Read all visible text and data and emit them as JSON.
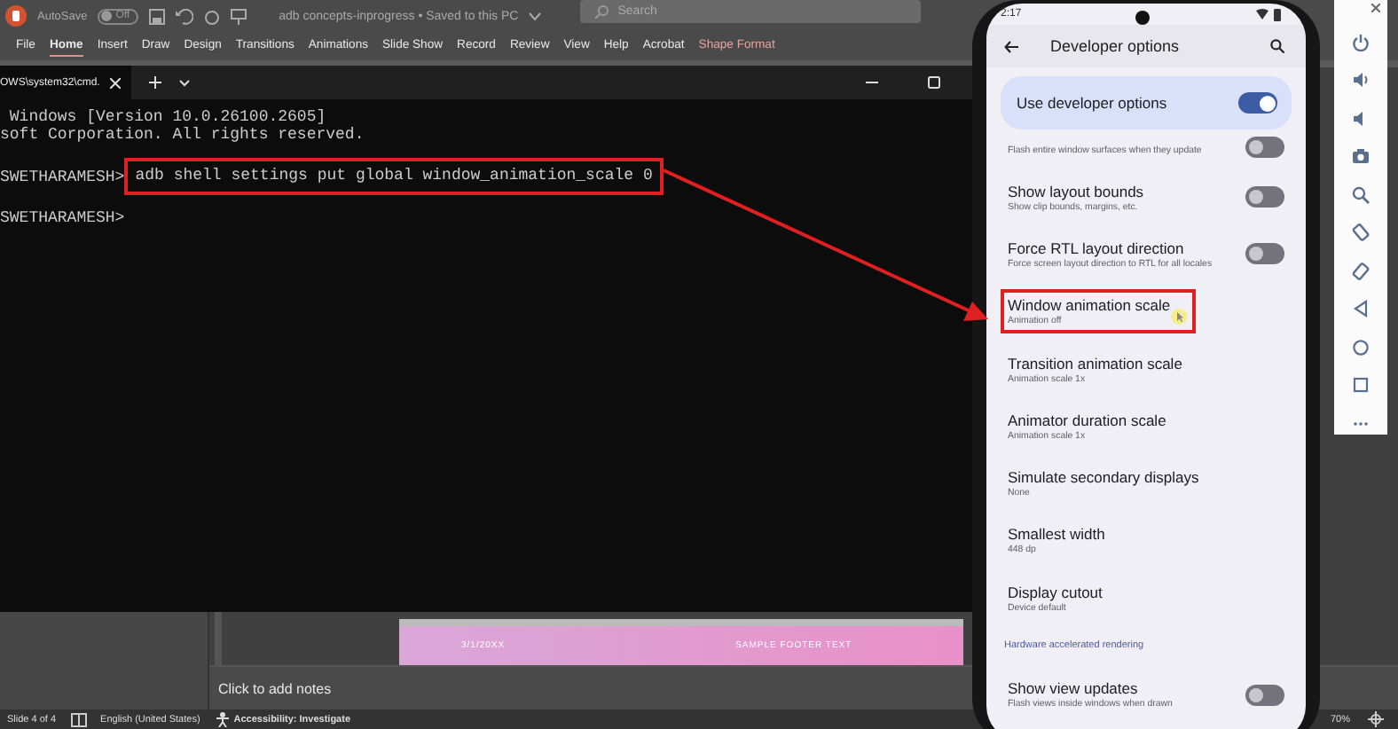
{
  "powerpoint": {
    "autosave_label": "AutoSave",
    "autosave": {
      "label": "Off",
      "on": false
    },
    "document_title": "adb concepts-inprogress • Saved to this PC",
    "search": {
      "placeholder": "Search"
    },
    "ribbon_tabs": [
      {
        "label": "File",
        "selected": false,
        "kind": "standard"
      },
      {
        "label": "Home",
        "selected": true,
        "kind": "standard"
      },
      {
        "label": "Insert",
        "selected": false,
        "kind": "standard"
      },
      {
        "label": "Draw",
        "selected": false,
        "kind": "standard"
      },
      {
        "label": "Design",
        "selected": false,
        "kind": "standard"
      },
      {
        "label": "Transitions",
        "selected": false,
        "kind": "standard"
      },
      {
        "label": "Animations",
        "selected": false,
        "kind": "standard"
      },
      {
        "label": "Slide Show",
        "selected": false,
        "kind": "standard"
      },
      {
        "label": "Record",
        "selected": false,
        "kind": "standard"
      },
      {
        "label": "Review",
        "selected": false,
        "kind": "standard"
      },
      {
        "label": "View",
        "selected": false,
        "kind": "standard"
      },
      {
        "label": "Help",
        "selected": false,
        "kind": "standard"
      },
      {
        "label": "Acrobat",
        "selected": false,
        "kind": "standard"
      },
      {
        "label": "Shape Format",
        "selected": false,
        "kind": "contextual"
      }
    ],
    "slide": {
      "date": "3/1/20XX",
      "footer": "SAMPLE FOOTER TEXT"
    },
    "notes_placeholder": "Click to add notes",
    "status_bar": {
      "slide": "Slide 4 of 4",
      "language": "English (United States)",
      "accessibility": "Accessibility: Investigate",
      "zoom": "70%"
    }
  },
  "terminal": {
    "tab_title": "OWS\\system32\\cmd.",
    "lines": [
      {
        "kind": "output",
        "text": " Windows [Version 10.0.26100.2605]"
      },
      {
        "kind": "output",
        "text": "soft Corporation. All rights reserved."
      },
      {
        "kind": "prompt",
        "prompt": "SWETHARAMESH>",
        "command": "adb shell settings put global window_animation_scale 0",
        "highlighted": true
      },
      {
        "kind": "prompt",
        "prompt": "SWETHARAMESH>"
      }
    ]
  },
  "phone": {
    "time": "2:17",
    "title": "Developer options",
    "master_switch": {
      "label": "Use developer options",
      "on": true
    },
    "settings": [
      {
        "kind": "toggle",
        "subtitle": "Flash entire window surfaces when they update",
        "on": false,
        "highlighted": false
      },
      {
        "kind": "toggle",
        "title": "Show layout bounds",
        "subtitle": "Show clip bounds, margins, etc.",
        "on": false,
        "highlighted": false
      },
      {
        "kind": "toggle",
        "title": "Force RTL layout direction",
        "subtitle": "Force screen layout direction to RTL for all locales",
        "on": false,
        "highlighted": false
      },
      {
        "kind": "value",
        "title": "Window animation scale",
        "subtitle": "Animation off",
        "highlighted": true
      },
      {
        "kind": "value",
        "title": "Transition animation scale",
        "subtitle": "Animation scale 1x",
        "highlighted": false
      },
      {
        "kind": "value",
        "title": "Animator duration scale",
        "subtitle": "Animation scale 1x",
        "highlighted": false
      },
      {
        "kind": "value",
        "title": "Simulate secondary displays",
        "subtitle": "None",
        "highlighted": false
      },
      {
        "kind": "value",
        "title": "Smallest width",
        "subtitle": "448 dp",
        "highlighted": false
      },
      {
        "kind": "value",
        "title": "Display cutout",
        "subtitle": "Device default",
        "highlighted": false
      },
      {
        "kind": "header",
        "title": "Hardware accelerated rendering"
      },
      {
        "kind": "toggle",
        "title": "Show view updates",
        "subtitle": "Flash views inside windows when drawn",
        "on": false,
        "highlighted": false
      }
    ]
  }
}
